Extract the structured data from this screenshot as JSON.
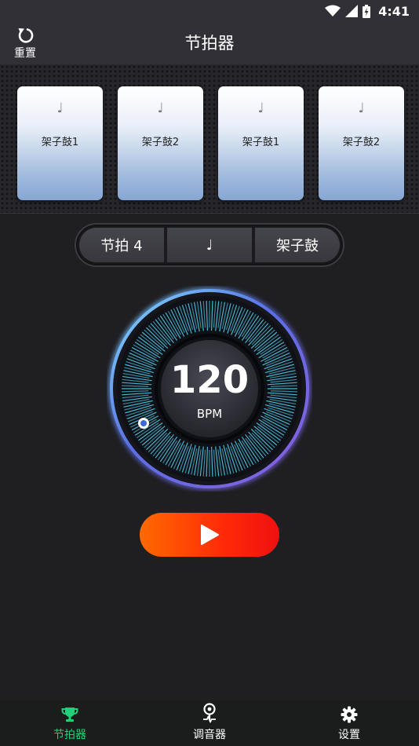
{
  "status_bar": {
    "time": "4:41"
  },
  "header": {
    "reset_label": "重置",
    "title": "节拍器"
  },
  "beat_cards": [
    {
      "note": "♩",
      "label": "架子鼓1"
    },
    {
      "note": "♩",
      "label": "架子鼓2"
    },
    {
      "note": "♩",
      "label": "架子鼓1"
    },
    {
      "note": "♩",
      "label": "架子鼓2"
    }
  ],
  "segmented": {
    "time_signature": "节拍 4",
    "note_value": "♩",
    "sound": "架子鼓"
  },
  "dial": {
    "bpm": "120",
    "unit": "BPM"
  },
  "bottom_nav": [
    {
      "label": "节拍器",
      "icon": "trophy-icon",
      "active": true
    },
    {
      "label": "调音器",
      "icon": "pin-tuner-icon",
      "active": false
    },
    {
      "label": "设置",
      "icon": "gear-icon",
      "active": false
    }
  ],
  "colors": {
    "accent": "#1fd27a",
    "play_start": "#ff6a00",
    "play_end": "#f01010",
    "dial_tick": "#4fc7e6"
  }
}
